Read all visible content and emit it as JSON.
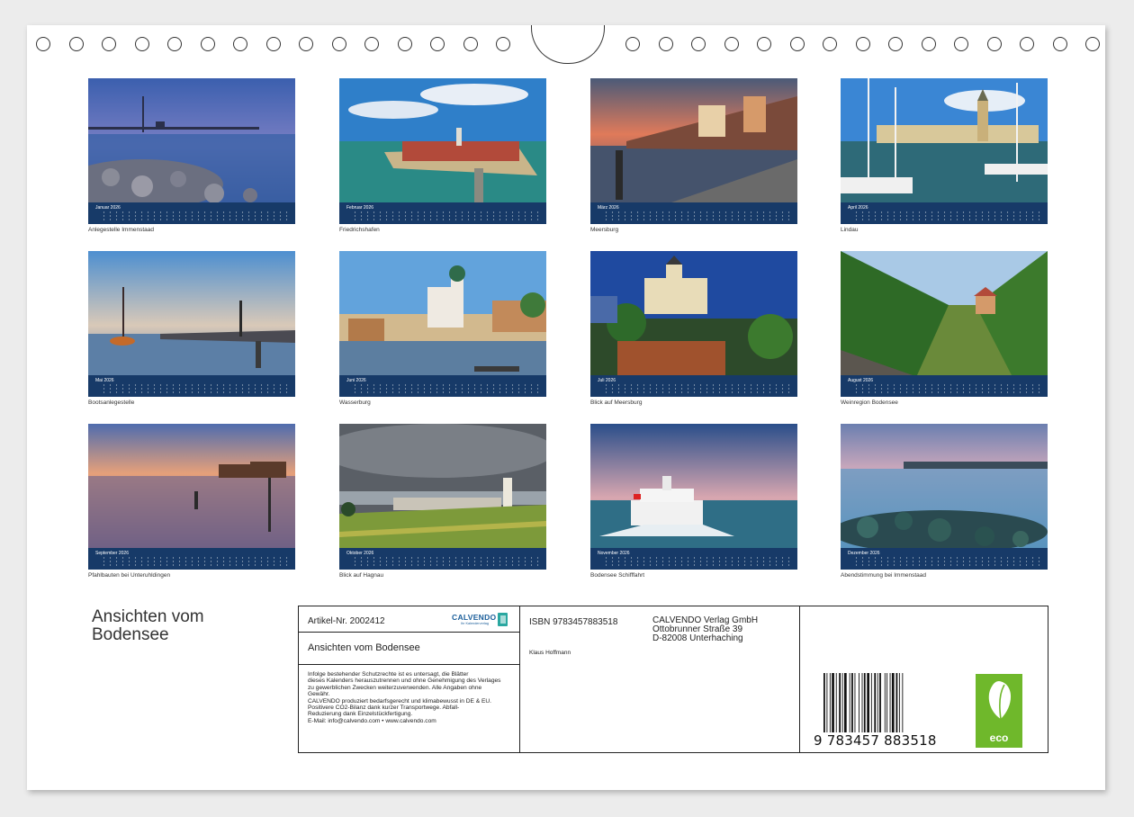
{
  "document": {
    "title_lines": [
      "Ansichten vom",
      "Bodensee"
    ],
    "photos": [
      {
        "month": "Januar 2026",
        "caption": "Anlegestelle Immenstaad"
      },
      {
        "month": "Februar 2026",
        "caption": "Friedrichshafen"
      },
      {
        "month": "März 2026",
        "caption": "Meersburg"
      },
      {
        "month": "April 2026",
        "caption": "Lindau"
      },
      {
        "month": "Mai 2026",
        "caption": "Bootsanlegestelle"
      },
      {
        "month": "Juni 2026",
        "caption": "Wasserburg"
      },
      {
        "month": "Juli 2026",
        "caption": "Blick auf Meersburg"
      },
      {
        "month": "August 2026",
        "caption": "Weinregion Bodensee"
      },
      {
        "month": "September 2026",
        "caption": "Pfahlbauten bei Unteruhldingen"
      },
      {
        "month": "Oktober 2026",
        "caption": "Blick auf Hagnau"
      },
      {
        "month": "November 2026",
        "caption": "Bodensee Schifffahrt"
      },
      {
        "month": "Dezember 2026",
        "caption": "Abendstimmung bei Immenstaad"
      }
    ]
  },
  "info": {
    "article_no": "Artikel-Nr. 2002412",
    "logo_text": "CALVENDO",
    "logo_sub": "Ihr Kalenderverlag",
    "product_title": "Ansichten vom Bodensee",
    "legal_lines": [
      "Infolge bestehender Schutzrechte ist es untersagt, die Blätter",
      "dieses Kalenders herauszutrennen und ohne Genehmigung des Verlages",
      "zu gewerblichen Zwecken weiterzuverwenden. Alle Angaben ohne",
      "Gewähr.",
      "CALVENDO produziert bedarfsgerecht und klimabewusst in DE & EU.",
      "Positivere CO2-Bilanz dank kurzer Transportwege. Abfall-",
      "Reduzierung dank Einzelstückfertigung.",
      "E-Mail: info@calvendo.com • www.calvendo.com"
    ],
    "isbn": "ISBN 9783457883518",
    "author": "Klaus Hoffmann",
    "publisher_lines": [
      "CALVENDO Verlag GmbH",
      "Ottobrunner Straße 39",
      "D-82008 Unterhaching"
    ],
    "ean_text": "9 783457 883518",
    "eco_label": "eco"
  },
  "colors": {
    "calendar_strip": "#173a68",
    "eco_green": "#6fb82b",
    "logo_blue": "#1a5e9a"
  }
}
